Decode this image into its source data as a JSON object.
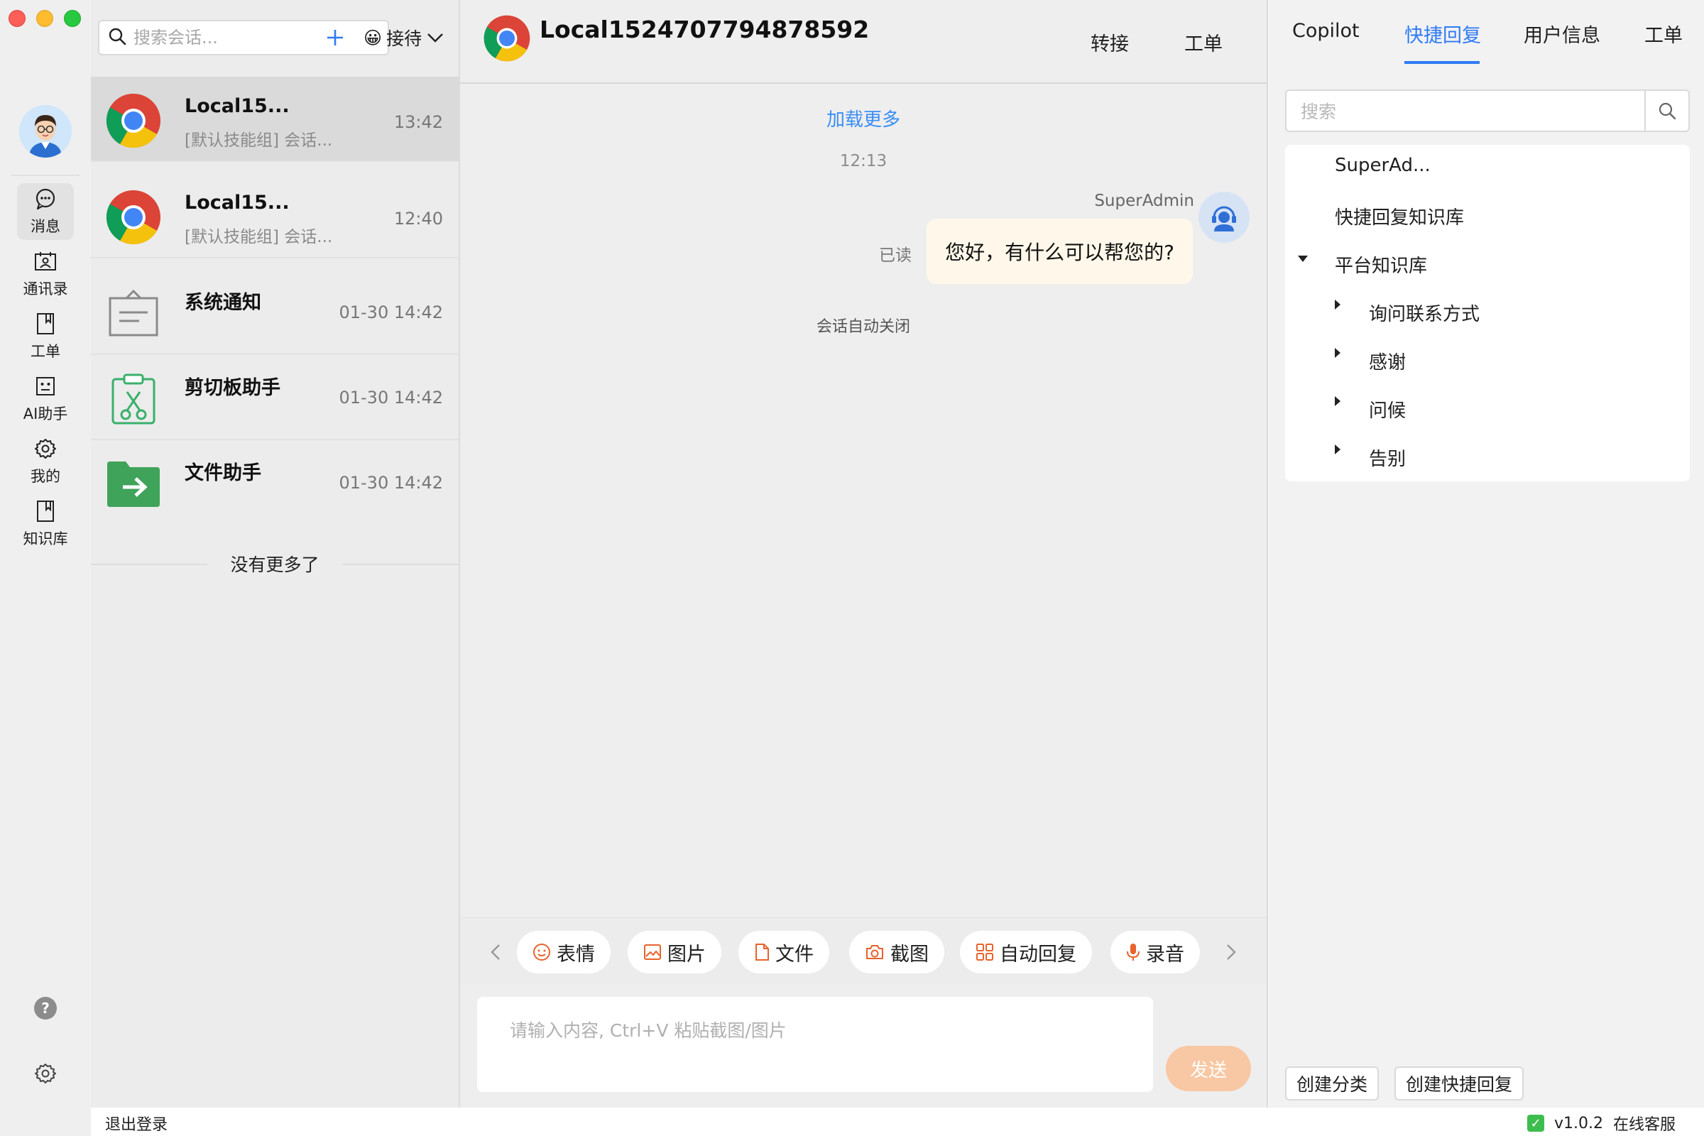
{
  "rail": {
    "items": [
      {
        "label": "消息",
        "icon": "message-icon"
      },
      {
        "label": "通讯录",
        "icon": "contacts-icon"
      },
      {
        "label": "工单",
        "icon": "ticket-icon"
      },
      {
        "label": "AI助手",
        "icon": "ai-robot-icon"
      },
      {
        "label": "我的",
        "icon": "gear-icon"
      },
      {
        "label": "知识库",
        "icon": "book-icon"
      }
    ]
  },
  "convlist": {
    "search_placeholder": "搜索会话...",
    "status_emoji": "😀",
    "status_label": "接待",
    "conversations": [
      {
        "name": "Local15...",
        "preview": "[默认技能组] 会话...",
        "time": "13:42"
      },
      {
        "name": "Local15...",
        "preview": "[默认技能组] 会话...",
        "time": "12:40"
      },
      {
        "name": "系统通知",
        "preview": "",
        "time": "01-30 14:42"
      },
      {
        "name": "剪切板助手",
        "preview": "",
        "time": "01-30 14:42"
      },
      {
        "name": "文件助手",
        "preview": "",
        "time": "01-30 14:42"
      }
    ],
    "no_more": "没有更多了"
  },
  "chat": {
    "title": "Local1524707794878592",
    "transfer_label": "转接",
    "ticket_label": "工单",
    "load_more": "加载更多",
    "message_time": "12:13",
    "sender": "SuperAdmin",
    "read_status": "已读",
    "message_text": "您好，有什么可以帮您的?",
    "closed_note": "会话自动关闭",
    "tools": [
      "表情",
      "图片",
      "文件",
      "截图",
      "自动回复",
      "录音"
    ],
    "input_placeholder": "请输入内容, Ctrl+V 粘贴截图/图片",
    "send_label": "发送"
  },
  "right": {
    "tabs": [
      "Copilot",
      "快捷回复",
      "用户信息",
      "工单"
    ],
    "active_tab": "快捷回复",
    "search_placeholder": "搜索",
    "tree": {
      "root1": "SuperAd...",
      "root2": "快捷回复知识库",
      "root3": "平台知识库",
      "children": [
        "询问联系方式",
        "感谢",
        "问候",
        "告别"
      ]
    },
    "create_category": "创建分类",
    "create_quick_reply": "创建快捷回复"
  },
  "statusbar": {
    "logout": "退出登录",
    "version": "v1.0.2",
    "online": "在线客服"
  },
  "colors": {
    "accent": "#2f7bf5",
    "link": "#3a8ef6",
    "send_button": "#f8c7a3",
    "bubble": "#fff8ea",
    "tool_icon": "#e8622c"
  }
}
